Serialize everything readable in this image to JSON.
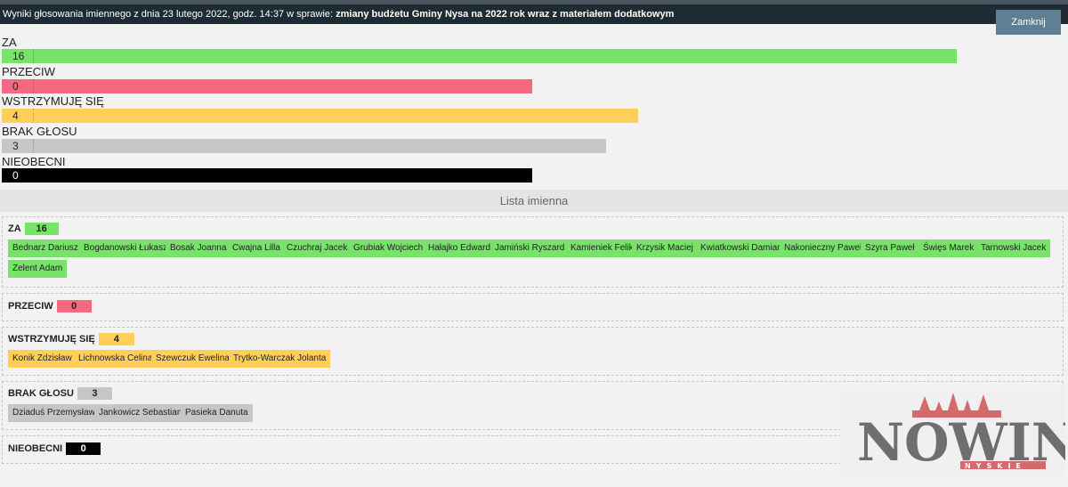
{
  "header": {
    "prefix": "Wyniki głosowania imiennego z dnia 23 lutego 2022, godz. 14:37 w sprawie: ",
    "subject": "zmiany budżetu Gminy Nysa na 2022 rok wraz z materiałem dodatkowym",
    "close_label": "Zamknij"
  },
  "chart_data": {
    "type": "bar",
    "categories": [
      "ZA",
      "PRZECIW",
      "WSTRZYMUJĘ SIĘ",
      "BRAK GŁOSU",
      "NIEOBECNI"
    ],
    "values": [
      16,
      0,
      4,
      3,
      0
    ],
    "colors": [
      "#77e369",
      "#f4697f",
      "#ffcf5a",
      "#c6c6c6",
      "#000000"
    ]
  },
  "list_title": "Lista imienna",
  "groups": [
    {
      "label": "ZA",
      "count": "16",
      "color": "#77e369",
      "names": [
        "Bednarz Dariusz",
        "Bogdanowski Łukasz",
        "Bosak Joanna",
        "Cwajna Lilla",
        "Czuchraj Jacek",
        "Grubiak Wojciech",
        "Hałajko Edward",
        "Jamiński Ryszard",
        "Kamieniek Feliks",
        "Krzysik Maciej",
        "Kwiatkowski Damian",
        "Nakonieczny Paweł",
        "Szyra Paweł",
        "Święs Marek",
        "Tarnowski Jacek",
        "Zelent Adam"
      ]
    },
    {
      "label": "PRZECIW",
      "count": "0",
      "color": "#f4697f",
      "names": []
    },
    {
      "label": "WSTRZYMUJĘ SIĘ",
      "count": "4",
      "color": "#ffcf5a",
      "names": [
        "Konik Zdzisław",
        "Lichnowska Celina",
        "Szewczuk Ewelina",
        "Trytko-Warczak Jolanta"
      ]
    },
    {
      "label": "BRAK GŁOSU",
      "count": "3",
      "color": "#c6c6c6",
      "names": [
        "Dziaduś Przemysław",
        "Jankowicz Sebastian",
        "Pasieka Danuta"
      ]
    },
    {
      "label": "NIEOBECNI",
      "count": "0",
      "color": "#000000",
      "names": []
    }
  ],
  "watermark": {
    "brand": "NOWINY",
    "sub": "NYSKIE"
  }
}
